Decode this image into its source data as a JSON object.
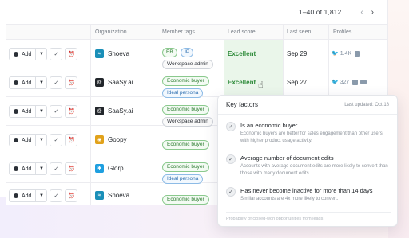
{
  "pagination": {
    "range": "1–40 of 1,812",
    "prev": "‹",
    "next": "›"
  },
  "columns": {
    "organization": "Organization",
    "member_tags": "Member tags",
    "lead_score": "Lead score",
    "last_seen": "Last seen",
    "profiles": "Profiles"
  },
  "add_label": "Add",
  "rows": [
    {
      "org": "Shoeva",
      "logo_color": "#1a8fb8",
      "logo_char": "≈",
      "tags": [
        "EB",
        "IP"
      ],
      "tags2": [
        "Workspace admin"
      ],
      "score": "Excellent",
      "seen": "Sep 29",
      "profiles": "1.4K"
    },
    {
      "org": "SaaSy.ai",
      "logo_color": "#22262b",
      "logo_char": "@",
      "tags": [
        "Economic buyer"
      ],
      "tags2": [
        "Ideal persona"
      ],
      "score": "Excellent",
      "seen": "Sep 27",
      "profiles": "327"
    },
    {
      "org": "SaaSy.ai",
      "logo_color": "#22262b",
      "logo_char": "@",
      "tags": [
        "Economic buyer"
      ],
      "tags2": [
        "Workspace admin"
      ]
    },
    {
      "org": "Goopy",
      "logo_color": "#e1a21b",
      "logo_char": "◉",
      "tags": [
        "Economic buyer"
      ],
      "tags2": []
    },
    {
      "org": "Glorp",
      "logo_color": "#1e9fe0",
      "logo_char": "✱",
      "tags": [
        "Economic buyer"
      ],
      "tags2": [
        "Ideal persona"
      ]
    },
    {
      "org": "Shoeva",
      "logo_color": "#1a8fb8",
      "logo_char": "≈",
      "tags": [
        "Economic buyer"
      ],
      "tags2": []
    }
  ],
  "tooltip": {
    "title": "Key factors",
    "updated": "Last updated: Oct 18",
    "factors": [
      {
        "title": "Is an economic buyer",
        "desc": "Economic buyers are better for sales engagement than other users with higher product usage activity."
      },
      {
        "title": "Average number of document edits",
        "desc": "Accounts with average document edits are more likely to convert than those with many document edits."
      },
      {
        "title": "Has never become inactive for more than 14 days",
        "desc": "Similar accounts are 4x more likely to convert."
      }
    ],
    "footer": "Probability of closed-won opportunities from leads"
  },
  "colors": {
    "accent_green": "#2e8b3a",
    "score_bg": "#eaf6ea",
    "tag_blue": "#2e6fb0"
  }
}
